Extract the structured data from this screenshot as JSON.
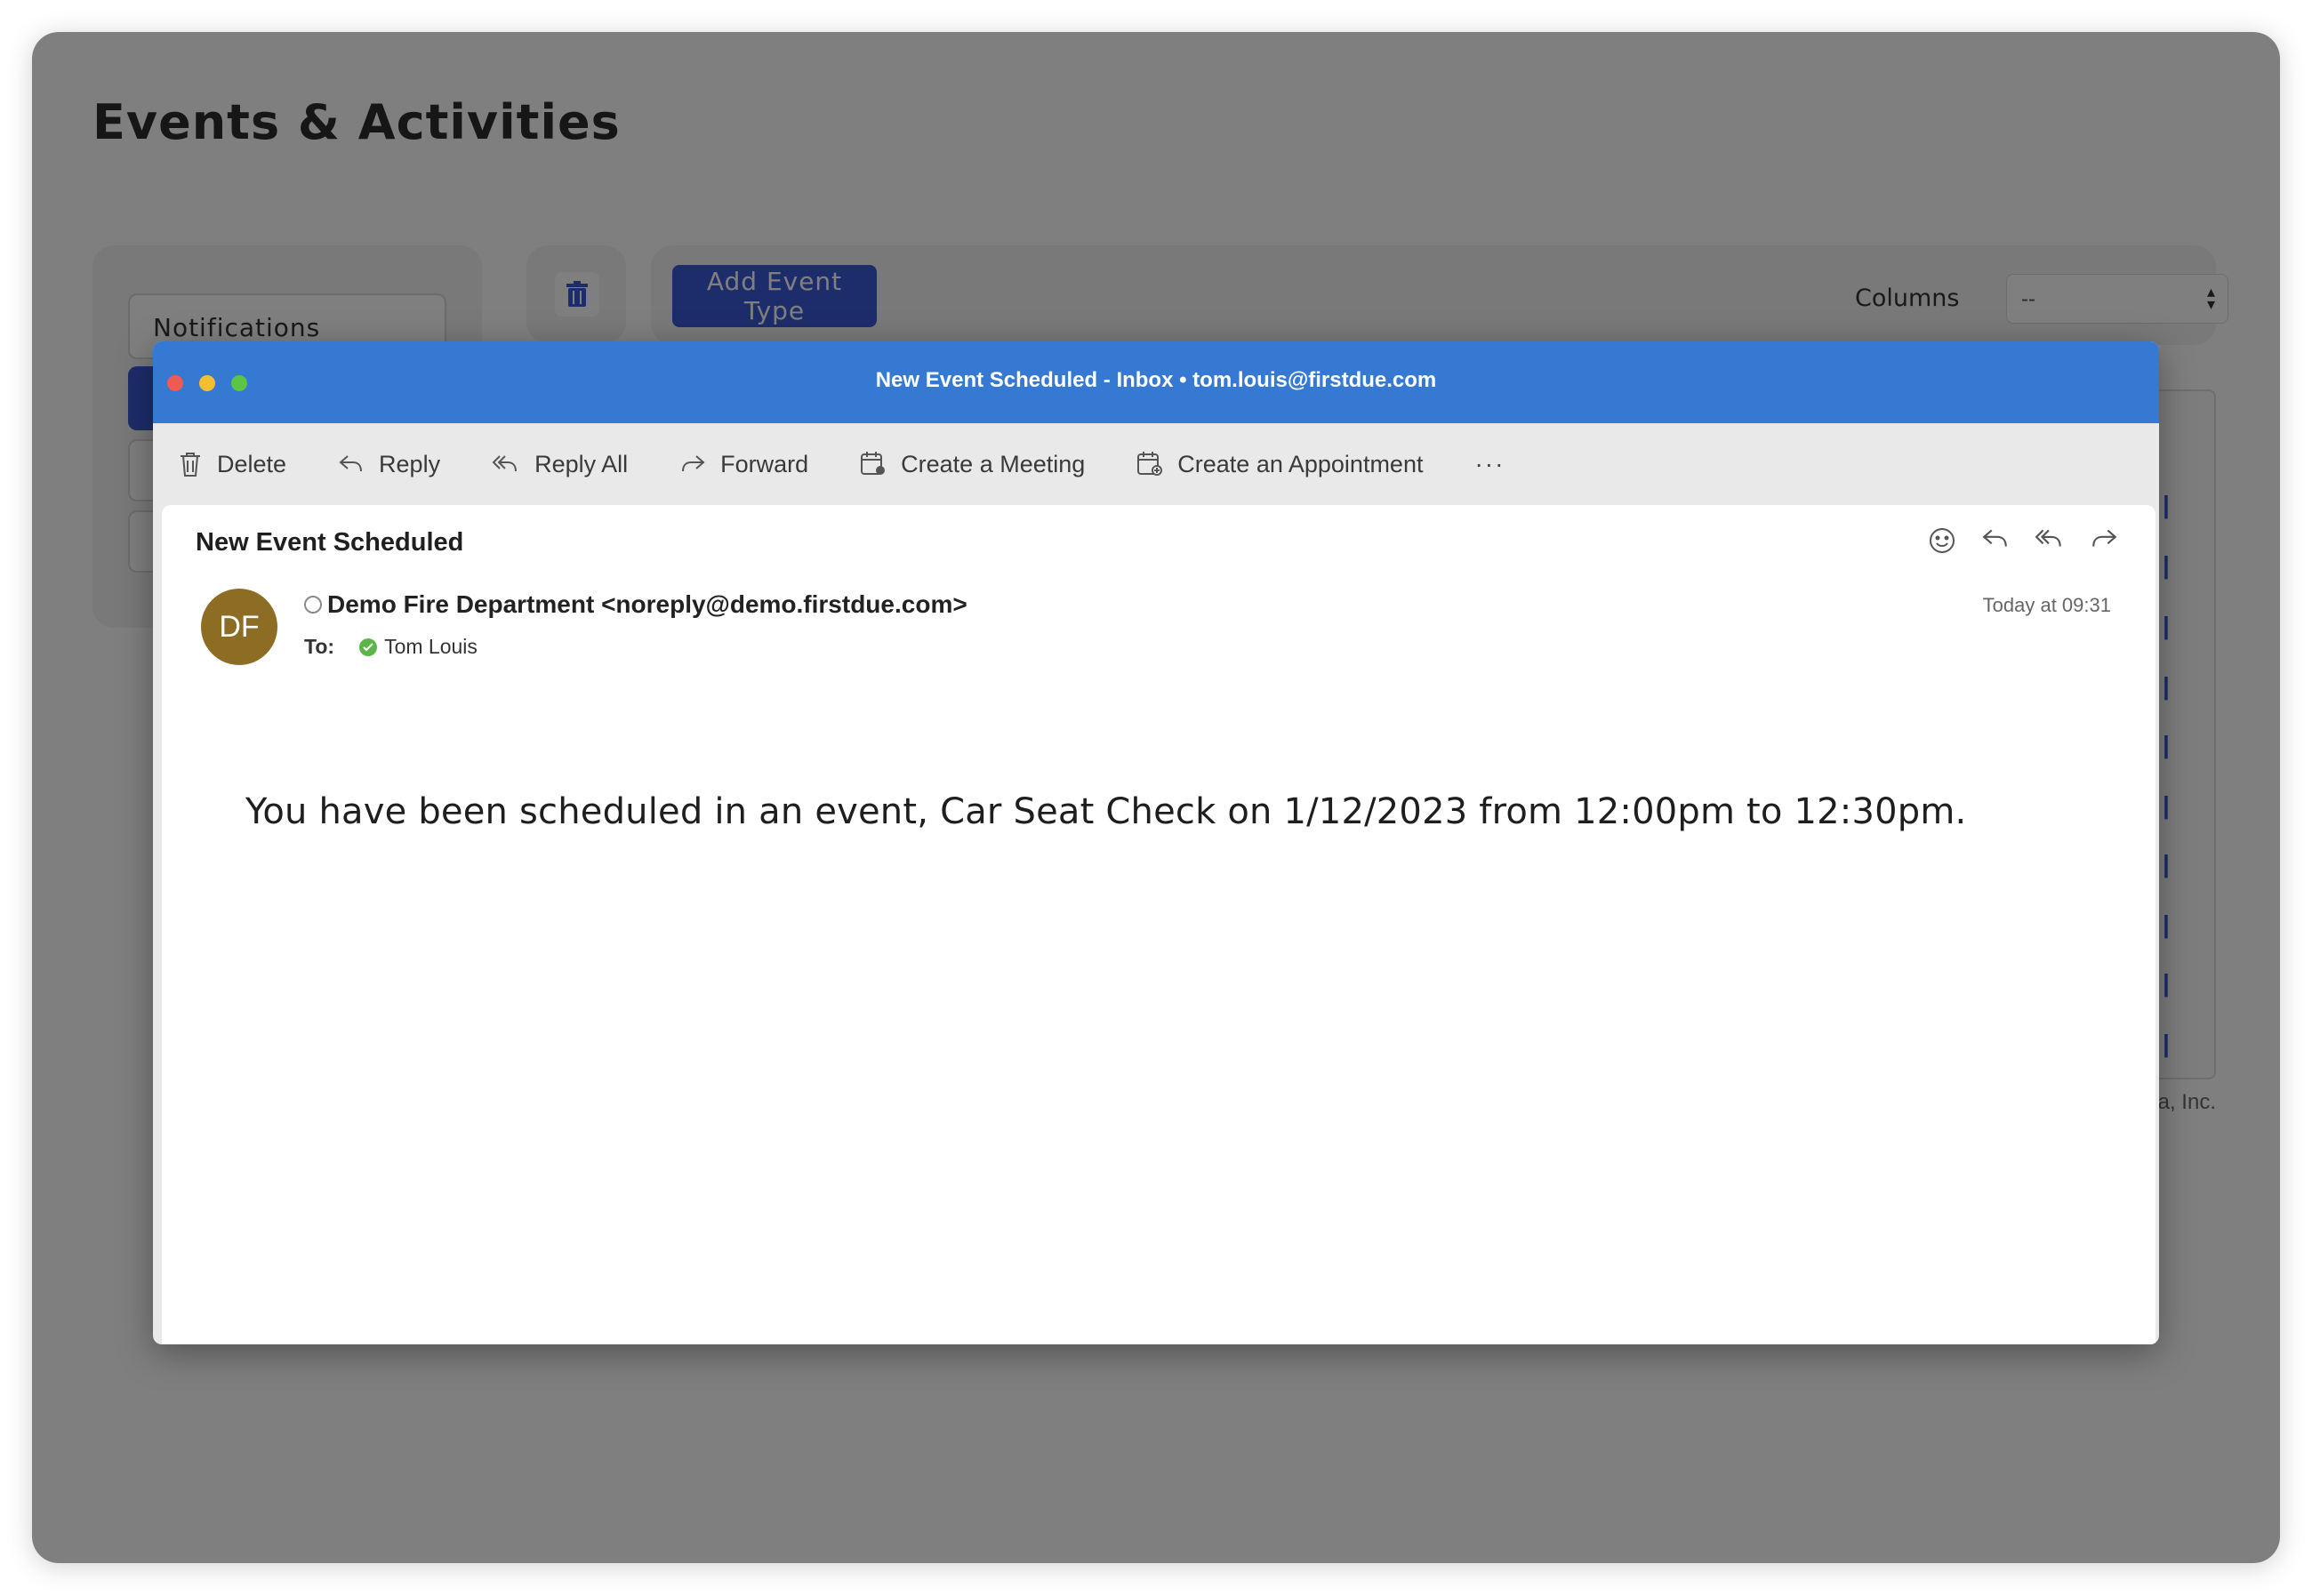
{
  "app": {
    "title": "Events & Activities",
    "sidebar": {
      "notifications_label": "Notifications"
    },
    "toolbar": {
      "add_event_type_label": "Add Event Type",
      "columns_label": "Columns",
      "columns_value": "--"
    },
    "footer_fragment": "a, Inc."
  },
  "mail": {
    "window_title": "New Event Scheduled - Inbox • tom.louis@firstdue.com",
    "toolbar": {
      "delete": "Delete",
      "reply": "Reply",
      "reply_all": "Reply All",
      "forward": "Forward",
      "create_meeting": "Create a Meeting",
      "create_appointment": "Create an Appointment",
      "more": "···"
    },
    "subject": "New Event Scheduled",
    "avatar_initials": "DF",
    "sender": "Demo Fire Department <noreply@demo.firstdue.com>",
    "to_label": "To:",
    "recipient": "Tom Louis",
    "timestamp": "Today at 09:31",
    "body": "You have been scheduled in an event, Car Seat Check on 1/12/2023 from 12:00pm to 12:30pm."
  },
  "colors": {
    "titlebar": "#3579d2",
    "primary_button": "#3b5bd6",
    "avatar": "#8d6d24",
    "recipient_status": "#5db54a"
  }
}
